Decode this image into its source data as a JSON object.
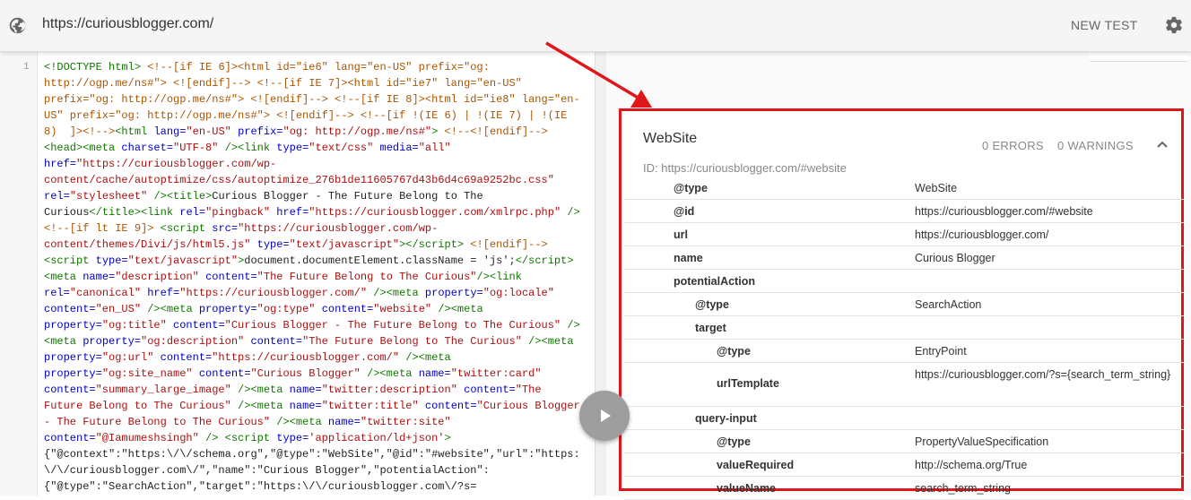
{
  "topbar": {
    "url": "https://curiousblogger.com/",
    "new_test_label": "NEW TEST"
  },
  "code_pane": {
    "line_number": "1"
  },
  "result_card": {
    "title": "WebSite",
    "errors": "0 ERRORS",
    "warnings": "0 WARNINGS",
    "id_text": "ID: https://curiousblogger.com/#website",
    "rows": [
      {
        "key": "@type",
        "value": "WebSite"
      },
      {
        "key": "@id",
        "value": "https://curiousblogger.com/#website"
      },
      {
        "key": "url",
        "value": "https://curiousblogger.com/"
      },
      {
        "key": "name",
        "value": "Curious Blogger"
      },
      {
        "key": "potentialAction",
        "value": ""
      },
      {
        "key": "@type",
        "value": "SearchAction"
      },
      {
        "key": "target",
        "value": ""
      },
      {
        "key": "@type",
        "value": "EntryPoint"
      },
      {
        "key": "urlTemplate",
        "value": "https://curiousblogger.com/?s={search_term_string}"
      },
      {
        "key": "query-input",
        "value": ""
      },
      {
        "key": "@type",
        "value": "PropertyValueSpecification"
      },
      {
        "key": "valueRequired",
        "value": "http://schema.org/True"
      },
      {
        "key": "valueName",
        "value": "search_term_string"
      }
    ]
  },
  "colors": {
    "highlight_border": "#e0161b",
    "arrow": "#e0161b"
  },
  "icons": [
    "globe-icon",
    "gear-icon",
    "chevron-up-icon",
    "play-icon"
  ]
}
